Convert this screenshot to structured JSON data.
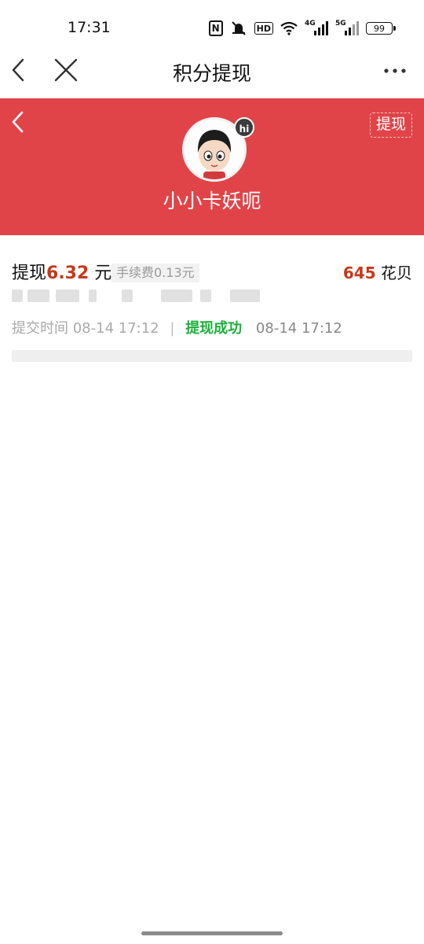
{
  "status_bar": {
    "time": "17:31",
    "nfc_label": "N",
    "hd_label": "HD",
    "signal1_label": "4G",
    "signal2_label": "5G",
    "battery": "99"
  },
  "nav": {
    "title": "积分提现"
  },
  "header": {
    "withdraw_button": "提现",
    "hi_badge": "hi",
    "username": "小小卡妖呃",
    "bg_color": "#e14448"
  },
  "record": {
    "withdraw_prefix": "提现",
    "amount": "6.32",
    "unit": " 元",
    "fee": "手续费0.13元",
    "points_value": "645",
    "points_unit": " 花贝",
    "submit_label": "提交时间",
    "submit_time": "08-14 17:12",
    "separator": "|",
    "status": "提现成功",
    "status_time": "08-14 17:12",
    "amount_color": "#c8371a",
    "status_color": "#1ab03a"
  }
}
